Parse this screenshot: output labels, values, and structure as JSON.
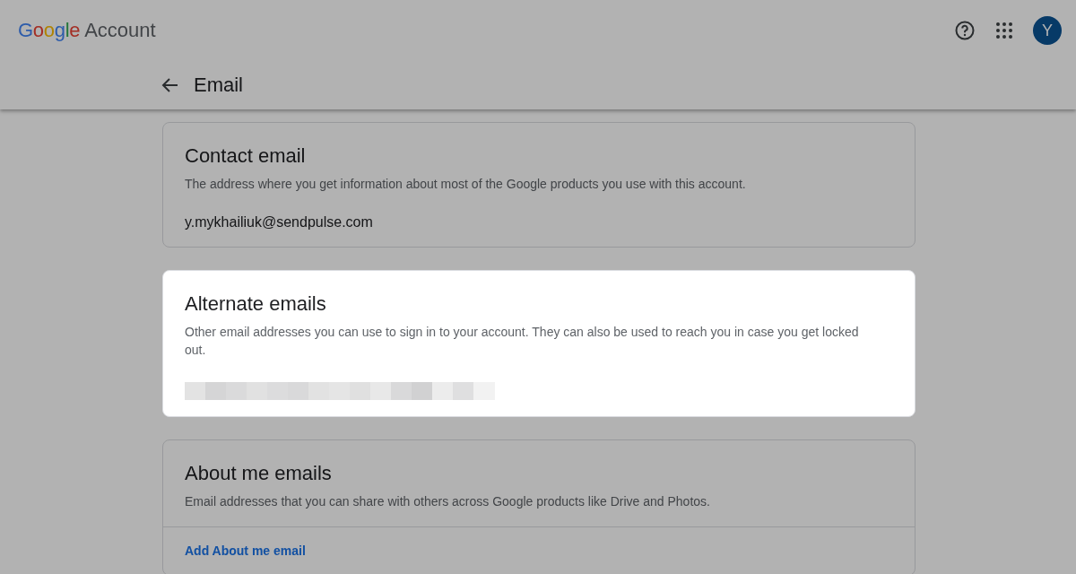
{
  "header": {
    "logo": {
      "brand": "Google",
      "product": "Account"
    },
    "avatar": "Y"
  },
  "page": {
    "title": "Email"
  },
  "cards": [
    {
      "kind": "value",
      "title": "Contact email",
      "description": "The address where you get information about most of the Google products you use with this account.",
      "value": "y.mykhailiuk@sendpulse.com",
      "highlighted": false
    },
    {
      "kind": "redacted",
      "title": "Alternate emails",
      "description": "Other email addresses you can use to sign in to your account. They can also be used to reach you in case you get locked out.",
      "highlighted": true
    },
    {
      "kind": "link",
      "title": "About me emails",
      "description": "Email addresses that you can share with others across Google products like Drive and Photos.",
      "link": "Add About me email",
      "highlighted": false
    }
  ]
}
